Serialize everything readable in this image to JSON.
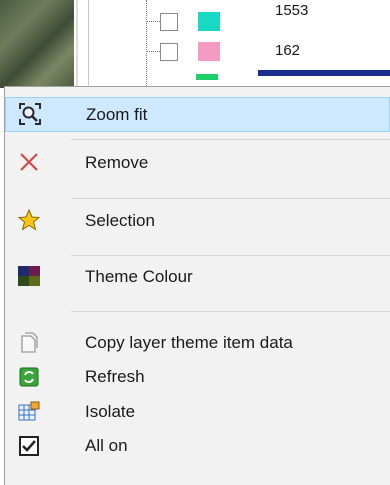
{
  "tree": {
    "rows": [
      {
        "label": "1553",
        "swatch": "#17d9c4"
      },
      {
        "label": "162",
        "swatch": "#f49ac3"
      }
    ],
    "partial_swatch": "#1fd06a",
    "selection_bar": "#1b2d8c"
  },
  "menu": {
    "items": [
      {
        "label": "Zoom fit",
        "icon": "zoom-fit-icon",
        "highlighted": true
      },
      {
        "label": "Remove",
        "icon": "remove-x-icon"
      },
      {
        "label": "Selection",
        "icon": "star-icon"
      },
      {
        "label": "Theme Colour",
        "icon": "theme-colour-icon"
      },
      {
        "label": "Copy layer theme item data",
        "icon": "copy-icon",
        "disabled": true
      },
      {
        "label": "Refresh",
        "icon": "refresh-icon"
      },
      {
        "label": "Isolate",
        "icon": "isolate-grid-icon"
      },
      {
        "label": "All on",
        "icon": "checkbox-checked-icon"
      }
    ]
  },
  "colors": {
    "highlight_bg": "#cde8ff",
    "highlight_border": "#99d1ff",
    "remove_x": "#d64545",
    "star": "#f5c518"
  }
}
